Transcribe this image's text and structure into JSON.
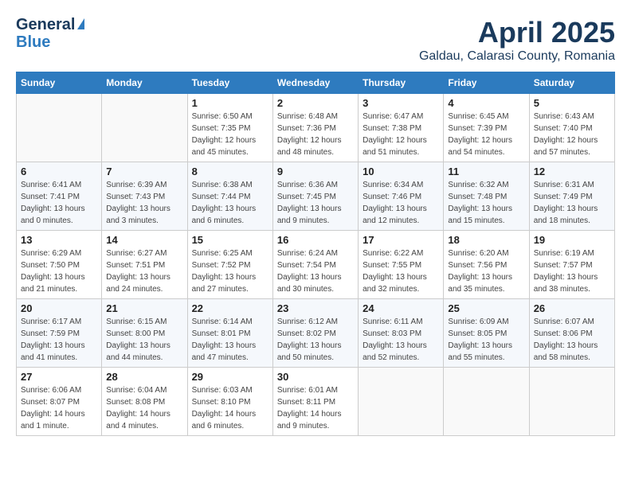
{
  "app": {
    "logo_line1": "General",
    "logo_line2": "Blue"
  },
  "calendar": {
    "title": "April 2025",
    "subtitle": "Galdau, Calarasi County, Romania",
    "headers": [
      "Sunday",
      "Monday",
      "Tuesday",
      "Wednesday",
      "Thursday",
      "Friday",
      "Saturday"
    ],
    "weeks": [
      [
        {
          "num": "",
          "info": ""
        },
        {
          "num": "",
          "info": ""
        },
        {
          "num": "1",
          "info": "Sunrise: 6:50 AM\nSunset: 7:35 PM\nDaylight: 12 hours\nand 45 minutes."
        },
        {
          "num": "2",
          "info": "Sunrise: 6:48 AM\nSunset: 7:36 PM\nDaylight: 12 hours\nand 48 minutes."
        },
        {
          "num": "3",
          "info": "Sunrise: 6:47 AM\nSunset: 7:38 PM\nDaylight: 12 hours\nand 51 minutes."
        },
        {
          "num": "4",
          "info": "Sunrise: 6:45 AM\nSunset: 7:39 PM\nDaylight: 12 hours\nand 54 minutes."
        },
        {
          "num": "5",
          "info": "Sunrise: 6:43 AM\nSunset: 7:40 PM\nDaylight: 12 hours\nand 57 minutes."
        }
      ],
      [
        {
          "num": "6",
          "info": "Sunrise: 6:41 AM\nSunset: 7:41 PM\nDaylight: 13 hours\nand 0 minutes."
        },
        {
          "num": "7",
          "info": "Sunrise: 6:39 AM\nSunset: 7:43 PM\nDaylight: 13 hours\nand 3 minutes."
        },
        {
          "num": "8",
          "info": "Sunrise: 6:38 AM\nSunset: 7:44 PM\nDaylight: 13 hours\nand 6 minutes."
        },
        {
          "num": "9",
          "info": "Sunrise: 6:36 AM\nSunset: 7:45 PM\nDaylight: 13 hours\nand 9 minutes."
        },
        {
          "num": "10",
          "info": "Sunrise: 6:34 AM\nSunset: 7:46 PM\nDaylight: 13 hours\nand 12 minutes."
        },
        {
          "num": "11",
          "info": "Sunrise: 6:32 AM\nSunset: 7:48 PM\nDaylight: 13 hours\nand 15 minutes."
        },
        {
          "num": "12",
          "info": "Sunrise: 6:31 AM\nSunset: 7:49 PM\nDaylight: 13 hours\nand 18 minutes."
        }
      ],
      [
        {
          "num": "13",
          "info": "Sunrise: 6:29 AM\nSunset: 7:50 PM\nDaylight: 13 hours\nand 21 minutes."
        },
        {
          "num": "14",
          "info": "Sunrise: 6:27 AM\nSunset: 7:51 PM\nDaylight: 13 hours\nand 24 minutes."
        },
        {
          "num": "15",
          "info": "Sunrise: 6:25 AM\nSunset: 7:52 PM\nDaylight: 13 hours\nand 27 minutes."
        },
        {
          "num": "16",
          "info": "Sunrise: 6:24 AM\nSunset: 7:54 PM\nDaylight: 13 hours\nand 30 minutes."
        },
        {
          "num": "17",
          "info": "Sunrise: 6:22 AM\nSunset: 7:55 PM\nDaylight: 13 hours\nand 32 minutes."
        },
        {
          "num": "18",
          "info": "Sunrise: 6:20 AM\nSunset: 7:56 PM\nDaylight: 13 hours\nand 35 minutes."
        },
        {
          "num": "19",
          "info": "Sunrise: 6:19 AM\nSunset: 7:57 PM\nDaylight: 13 hours\nand 38 minutes."
        }
      ],
      [
        {
          "num": "20",
          "info": "Sunrise: 6:17 AM\nSunset: 7:59 PM\nDaylight: 13 hours\nand 41 minutes."
        },
        {
          "num": "21",
          "info": "Sunrise: 6:15 AM\nSunset: 8:00 PM\nDaylight: 13 hours\nand 44 minutes."
        },
        {
          "num": "22",
          "info": "Sunrise: 6:14 AM\nSunset: 8:01 PM\nDaylight: 13 hours\nand 47 minutes."
        },
        {
          "num": "23",
          "info": "Sunrise: 6:12 AM\nSunset: 8:02 PM\nDaylight: 13 hours\nand 50 minutes."
        },
        {
          "num": "24",
          "info": "Sunrise: 6:11 AM\nSunset: 8:03 PM\nDaylight: 13 hours\nand 52 minutes."
        },
        {
          "num": "25",
          "info": "Sunrise: 6:09 AM\nSunset: 8:05 PM\nDaylight: 13 hours\nand 55 minutes."
        },
        {
          "num": "26",
          "info": "Sunrise: 6:07 AM\nSunset: 8:06 PM\nDaylight: 13 hours\nand 58 minutes."
        }
      ],
      [
        {
          "num": "27",
          "info": "Sunrise: 6:06 AM\nSunset: 8:07 PM\nDaylight: 14 hours\nand 1 minute."
        },
        {
          "num": "28",
          "info": "Sunrise: 6:04 AM\nSunset: 8:08 PM\nDaylight: 14 hours\nand 4 minutes."
        },
        {
          "num": "29",
          "info": "Sunrise: 6:03 AM\nSunset: 8:10 PM\nDaylight: 14 hours\nand 6 minutes."
        },
        {
          "num": "30",
          "info": "Sunrise: 6:01 AM\nSunset: 8:11 PM\nDaylight: 14 hours\nand 9 minutes."
        },
        {
          "num": "",
          "info": ""
        },
        {
          "num": "",
          "info": ""
        },
        {
          "num": "",
          "info": ""
        }
      ]
    ]
  }
}
